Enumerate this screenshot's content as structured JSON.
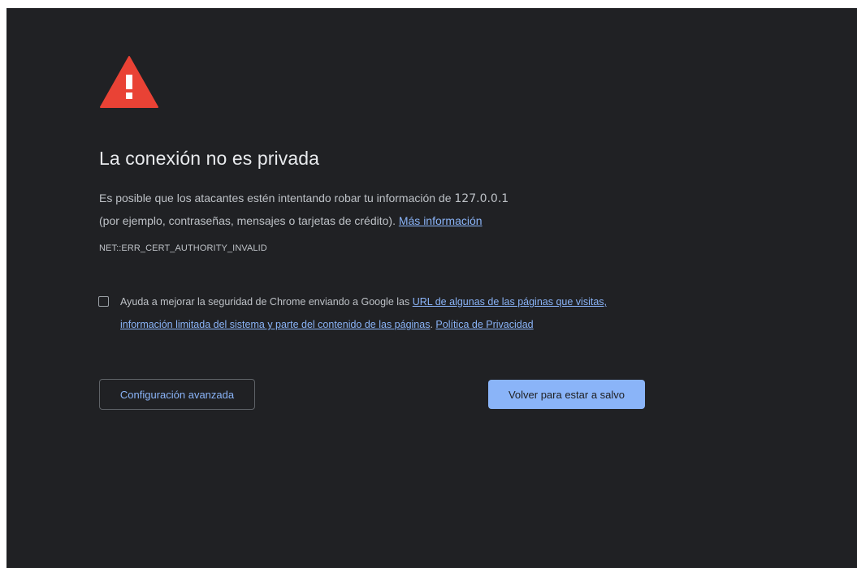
{
  "page": {
    "title": "La conexión no es privada",
    "description_part1": "Es posible que los atacantes estén intentando robar tu información de ",
    "host": "127.0.0.1",
    "description_part2": "(por ejemplo, contraseñas, mensajes o tarjetas de crédito).",
    "more_info_link": "Más información",
    "error_code": "NET::ERR_CERT_AUTHORITY_INVALID"
  },
  "optin": {
    "checked": false,
    "text_before": "Ayuda a mejorar la seguridad de Chrome enviando a Google las ",
    "link_text": "URL de algunas de las páginas que visitas, información limitada del sistema y parte del contenido de las páginas",
    "separator": ". ",
    "privacy_link": "Política de Privacidad"
  },
  "buttons": {
    "advanced_label": "Configuración avanzada",
    "back_label": "Volver para estar a salvo"
  },
  "icons": {
    "warning": "warning-triangle-icon"
  },
  "colors": {
    "background": "#202124",
    "warning_red": "#e94235",
    "link_blue": "#8ab4f8",
    "primary_button": "#8ab4f8",
    "title_text": "#e8eaed",
    "body_text": "#bdc1c6"
  }
}
